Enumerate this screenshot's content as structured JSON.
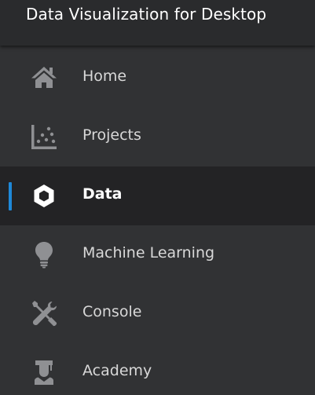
{
  "app": {
    "title": "Data Visualization for Desktop"
  },
  "colors": {
    "background": "#313234",
    "header": "#2a2b2d",
    "active_background": "#232325",
    "active_indicator": "#1e88d8",
    "icon": "#8f9093",
    "active_icon": "#ffffff",
    "text": "#d8d8d8",
    "active_text": "#ffffff"
  },
  "nav": {
    "items": [
      {
        "label": "Home",
        "icon": "home-icon",
        "active": false
      },
      {
        "label": "Projects",
        "icon": "scatter-chart-icon",
        "active": false
      },
      {
        "label": "Data",
        "icon": "hexagon-icon",
        "active": true
      },
      {
        "label": "Machine Learning",
        "icon": "lightbulb-icon",
        "active": false
      },
      {
        "label": "Console",
        "icon": "wrench-screwdriver-icon",
        "active": false
      },
      {
        "label": "Academy",
        "icon": "graduation-icon",
        "active": false
      }
    ]
  }
}
